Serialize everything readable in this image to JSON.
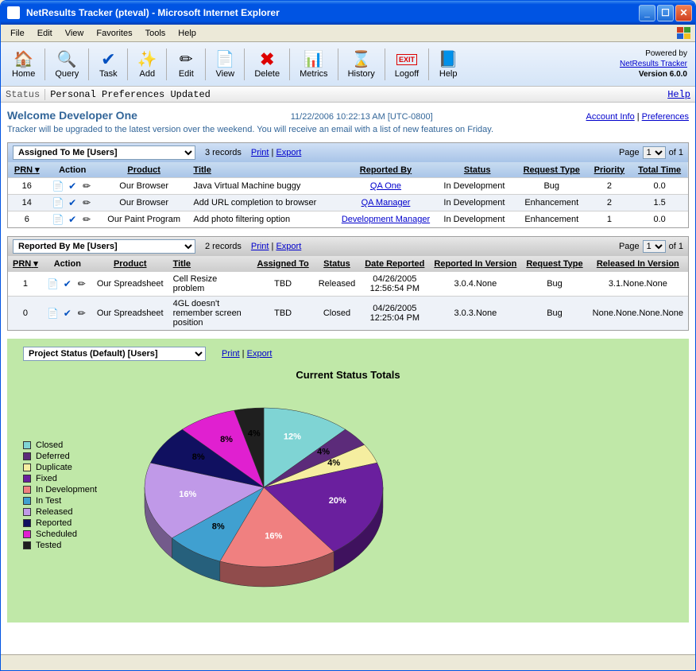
{
  "window_title": "NetResults Tracker (pteval) - Microsoft Internet Explorer",
  "menu": [
    "File",
    "Edit",
    "View",
    "Favorites",
    "Tools",
    "Help"
  ],
  "toolbar": [
    {
      "label": "Home",
      "icon": "🏠"
    },
    {
      "label": "Query",
      "icon": "🔍"
    },
    {
      "label": "Task",
      "icon": "✔"
    },
    {
      "label": "Add",
      "icon": "✨"
    },
    {
      "label": "Edit",
      "icon": "✏"
    },
    {
      "label": "View",
      "icon": "📄"
    },
    {
      "label": "Delete",
      "icon": "✖"
    },
    {
      "label": "Metrics",
      "icon": "📊"
    },
    {
      "label": "History",
      "icon": "⌛"
    },
    {
      "label": "Logoff",
      "icon": "EXIT"
    },
    {
      "label": "Help",
      "icon": "📘"
    }
  ],
  "powered_by": "Powered by",
  "powered_link": "NetResults Tracker",
  "version": "Version 6.0.0",
  "status_label": "Status",
  "status_text": "Personal Preferences Updated",
  "help_label": "Help",
  "welcome_title": "Welcome Developer One",
  "welcome_date": "11/22/2006 10:22:13 AM [UTC-0800]",
  "account_info": "Account Info",
  "preferences": "Preferences",
  "welcome_msg": "Tracker will be upgraded to the latest version over the weekend. You will receive an email with a list of new features on Friday.",
  "print_label": "Print",
  "export_label": "Export",
  "page_label": "Page",
  "of_label": "of 1",
  "page_value": "1",
  "panels": {
    "assigned": {
      "title": "Assigned To Me [Users]",
      "records": "3 records",
      "cols": [
        "PRN",
        "Action",
        "Product",
        "Title",
        "Reported By",
        "Status",
        "Request Type",
        "Priority",
        "Total Time"
      ],
      "rows": [
        {
          "prn": "16",
          "product": "Our Browser",
          "title": "Java Virtual Machine buggy",
          "reported_by": "QA One",
          "status": "In Development",
          "request_type": "Bug",
          "priority": "2",
          "total_time": "0.0"
        },
        {
          "prn": "14",
          "product": "Our Browser",
          "title": "Add URL completion to browser",
          "reported_by": "QA Manager",
          "status": "In Development",
          "request_type": "Enhancement",
          "priority": "2",
          "total_time": "1.5"
        },
        {
          "prn": "6",
          "product": "Our Paint Program",
          "title": "Add photo filtering option",
          "reported_by": "Development Manager",
          "status": "In Development",
          "request_type": "Enhancement",
          "priority": "1",
          "total_time": "0.0"
        }
      ]
    },
    "reported": {
      "title": "Reported By Me [Users]",
      "records": "2 records",
      "cols": [
        "PRN",
        "Action",
        "Product",
        "Title",
        "Assigned To",
        "Status",
        "Date Reported",
        "Reported In Version",
        "Request Type",
        "Released In Version"
      ],
      "rows": [
        {
          "prn": "1",
          "product": "Our Spreadsheet",
          "title": "Cell Resize problem",
          "assigned_to": "TBD",
          "status": "Released",
          "date_reported": "04/26/2005 12:56:54 PM",
          "in_version": "3.0.4.None",
          "request_type": "Bug",
          "released_in": "3.1.None.None"
        },
        {
          "prn": "0",
          "product": "Our Spreadsheet",
          "title": "4GL doesn't remember screen position",
          "assigned_to": "TBD",
          "status": "Closed",
          "date_reported": "04/26/2005 12:25:04 PM",
          "in_version": "3.0.3.None",
          "request_type": "Bug",
          "released_in": "None.None.None.None"
        }
      ]
    },
    "project": {
      "title": "Project Status (Default) [Users]"
    }
  },
  "chart_data": {
    "type": "pie",
    "title": "Current Status Totals",
    "series": [
      {
        "name": "Closed",
        "value": 12,
        "color": "#7fd4d4"
      },
      {
        "name": "Deferred",
        "value": 4,
        "color": "#5c2b7a"
      },
      {
        "name": "Duplicate",
        "value": 4,
        "color": "#f5eea0"
      },
      {
        "name": "Fixed",
        "value": 20,
        "color": "#6a1f9e"
      },
      {
        "name": "In Development",
        "value": 16,
        "color": "#f08080"
      },
      {
        "name": "In Test",
        "value": 8,
        "color": "#40a0d0"
      },
      {
        "name": "Released",
        "value": 16,
        "color": "#c099e8"
      },
      {
        "name": "Reported",
        "value": 8,
        "color": "#101060"
      },
      {
        "name": "Scheduled",
        "value": 8,
        "color": "#e020d0"
      },
      {
        "name": "Tested",
        "value": 4,
        "color": "#1f1f1f"
      }
    ]
  }
}
